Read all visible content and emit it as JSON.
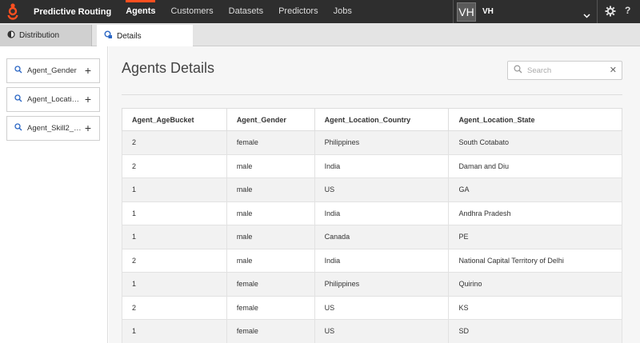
{
  "app": {
    "title": "Predictive Routing",
    "nav": [
      "Agents",
      "Customers",
      "Datasets",
      "Predictors",
      "Jobs"
    ],
    "active_nav": "Agents",
    "user_initials": "VH",
    "user_name": "VH",
    "accent_color": "#ff4f1f"
  },
  "tabs": [
    {
      "label": "Distribution",
      "icon": "half-circle-icon",
      "active": false
    },
    {
      "label": "Details",
      "icon": "details-icon",
      "active": true
    }
  ],
  "sidebar": {
    "items": [
      {
        "label": "Agent_Gender"
      },
      {
        "label": "Agent_Location..."
      },
      {
        "label": "Agent_Skill2_L..."
      }
    ]
  },
  "main": {
    "title": "Agents Details",
    "search_placeholder": "Search"
  },
  "table": {
    "columns": [
      "Agent_AgeBucket",
      "Agent_Gender",
      "Agent_Location_Country",
      "Agent_Location_State"
    ],
    "rows": [
      [
        "2",
        "female",
        "Philippines",
        "South Cotabato"
      ],
      [
        "2",
        "male",
        "India",
        "Daman and Diu"
      ],
      [
        "1",
        "male",
        "US",
        "GA"
      ],
      [
        "1",
        "male",
        "India",
        "Andhra Pradesh"
      ],
      [
        "1",
        "male",
        "Canada",
        "PE"
      ],
      [
        "2",
        "male",
        "India",
        "National Capital Territory of Delhi"
      ],
      [
        "1",
        "female",
        "Philippines",
        "Quirino"
      ],
      [
        "2",
        "female",
        "US",
        "KS"
      ],
      [
        "1",
        "female",
        "US",
        "SD"
      ]
    ]
  }
}
